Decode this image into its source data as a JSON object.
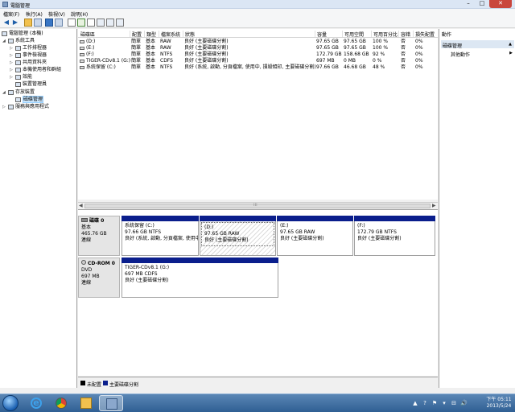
{
  "window": {
    "title": "電腦管理",
    "min_glyph": "–",
    "max_glyph": "□",
    "close_glyph": "✕"
  },
  "menu": [
    "檔案(F)",
    "執行(A)",
    "檢視(V)",
    "說明(H)"
  ],
  "toolbar": {
    "back": "◀",
    "forward": "▶",
    "tools": [
      "folder-icon",
      "console-icon",
      "help-icon",
      "properties-icon",
      "refresh-icon",
      "check-icon",
      "delete-icon",
      "open-icon",
      "search-icon",
      "zoom-icon"
    ]
  },
  "tree": [
    {
      "label": "電腦管理 (本機)",
      "exp": "",
      "level": 0
    },
    {
      "label": "系統工具",
      "exp": "◢",
      "level": 1
    },
    {
      "label": "工作排程器",
      "exp": "▷",
      "level": 2
    },
    {
      "label": "事件檢視器",
      "exp": "▷",
      "level": 2
    },
    {
      "label": "共用資料夾",
      "exp": "▷",
      "level": 2
    },
    {
      "label": "本機使用者和群組",
      "exp": "▷",
      "level": 2
    },
    {
      "label": "效能",
      "exp": "▷",
      "level": 2
    },
    {
      "label": "裝置管理員",
      "exp": "",
      "level": 2
    },
    {
      "label": "存放裝置",
      "exp": "◢",
      "level": 1
    },
    {
      "label": "磁碟管理",
      "exp": "",
      "level": 2,
      "selected": true
    },
    {
      "label": "服務與應用程式",
      "exp": "▷",
      "level": 1
    }
  ],
  "volume_headers": [
    "磁碟區",
    "配置",
    "類型",
    "檔案系統",
    "狀態",
    "容量",
    "可用空間",
    "可用百分比",
    "容錯",
    "損失配置"
  ],
  "volumes": [
    [
      "(D:)",
      "簡單",
      "基本",
      "RAW",
      "良好 (主要磁碟分割)",
      "97.65 GB",
      "97.65 GB",
      "100 %",
      "否",
      "0%"
    ],
    [
      "(E:)",
      "簡單",
      "基本",
      "RAW",
      "良好 (主要磁碟分割)",
      "97.65 GB",
      "97.65 GB",
      "100 %",
      "否",
      "0%"
    ],
    [
      "(F:)",
      "簡單",
      "基本",
      "NTFS",
      "良好 (主要磁碟分割)",
      "172.79 GB",
      "158.68 GB",
      "92 %",
      "否",
      "0%"
    ],
    [
      "TIGER-CDv8.1 (G:)",
      "簡單",
      "基本",
      "CDFS",
      "良好 (主要磁碟分割)",
      "697 MB",
      "0 MB",
      "0 %",
      "否",
      "0%"
    ],
    [
      "系統保留 (C:)",
      "簡單",
      "基本",
      "NTFS",
      "良好 (系統, 啟動, 分頁檔案, 使用中, 損毀傾印, 主要磁碟分割)",
      "97.66 GB",
      "46.68 GB",
      "48 %",
      "否",
      "0%"
    ]
  ],
  "disks": [
    {
      "name": "磁碟 0",
      "type": "基本",
      "size": "465.76 GB",
      "status": "連線",
      "partitions": [
        {
          "name": "系統保留 (C:)",
          "size": "97.66 GB NTFS",
          "status": "良好 (系統, 啟動, 分頁檔案, 使用中"
        },
        {
          "name": "(D:)",
          "size": "97.65 GB RAW",
          "status": "良好 (主要磁碟分割)"
        },
        {
          "name": "(E:)",
          "size": "97.65 GB RAW",
          "status": "良好 (主要磁碟分割)"
        },
        {
          "name": "(F:)",
          "size": "172.79 GB NTFS",
          "status": "良好 (主要磁碟分割)"
        }
      ]
    },
    {
      "name": "CD-ROM 0",
      "type": "DVD",
      "size": "697 MB",
      "status": "連線",
      "partitions": [
        {
          "name": "TIGER-CDv8.1 (G:)",
          "size": "697 MB CDFS",
          "status": "良好 (主要磁碟分割)"
        }
      ]
    }
  ],
  "legend": [
    {
      "label": "未配置",
      "color": "#000000"
    },
    {
      "label": "主要磁碟分割",
      "color": "#0a1e8c"
    }
  ],
  "actions": {
    "header": "動作",
    "group": "磁碟管理",
    "group_arrow": "▲",
    "item": "其他動作",
    "item_arrow": "▶"
  },
  "scroll": {
    "left": "◀",
    "right": "▶",
    "grip": "⁞⁞⁞"
  },
  "taskbar": {
    "time": "下午 05:11",
    "date": "2013/5/24",
    "tray_icons": [
      "▲",
      "?",
      "⚑",
      "▾",
      "⊟",
      "🔊"
    ]
  },
  "colors": {
    "primary_partition": "#0a1e8c",
    "selection": "#cce8ff",
    "taskbar": "#2f5f93"
  }
}
